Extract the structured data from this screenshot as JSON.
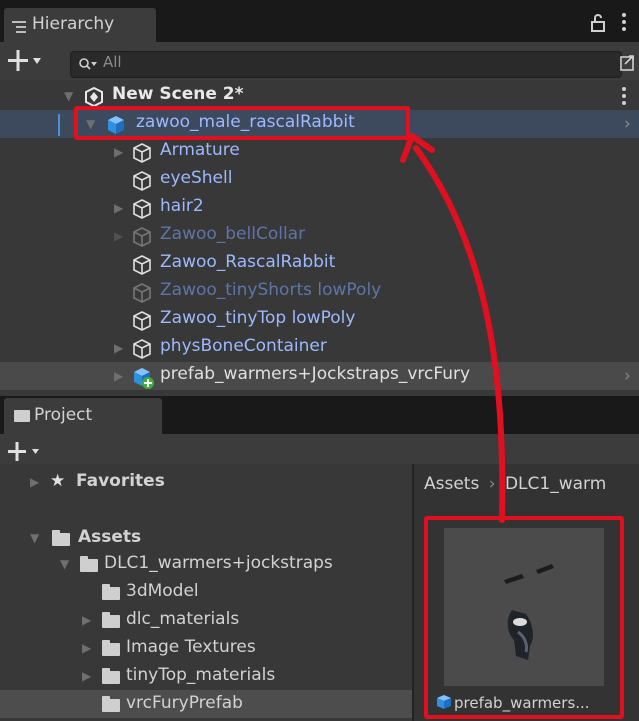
{
  "hierarchy": {
    "tab_label": "Hierarchy",
    "search_placeholder": "All",
    "scene_name": "New Scene 2*",
    "items": [
      {
        "label": "zawoo_male_rascalRabbit"
      },
      {
        "label": "Armature"
      },
      {
        "label": "eyeShell"
      },
      {
        "label": "hair2"
      },
      {
        "label": "Zawoo_bellCollar"
      },
      {
        "label": "Zawoo_RascalRabbit"
      },
      {
        "label": "Zawoo_tinyShorts lowPoly"
      },
      {
        "label": "Zawoo_tinyTop lowPoly"
      },
      {
        "label": "physBoneContainer"
      },
      {
        "label": "prefab_warmers+Jockstraps_vrcFury"
      }
    ]
  },
  "project": {
    "tab_label": "Project",
    "favorites_label": "Favorites",
    "assets_label": "Assets",
    "folders": [
      {
        "label": "DLC1_warmers+jockstraps"
      },
      {
        "label": "3dModel"
      },
      {
        "label": "dlc_materials"
      },
      {
        "label": "Image Textures"
      },
      {
        "label": "tinyTop_materials"
      },
      {
        "label": "vrcFuryPrefab"
      }
    ],
    "breadcrumb": {
      "root": "Assets",
      "separator": "›",
      "current": "DLC1_warm"
    },
    "asset_label": "prefab_warmers..."
  },
  "colors": {
    "highlight": "#e01020",
    "blue_text": "#9cb8ff",
    "prefab_blue": "#3fa7ff"
  }
}
